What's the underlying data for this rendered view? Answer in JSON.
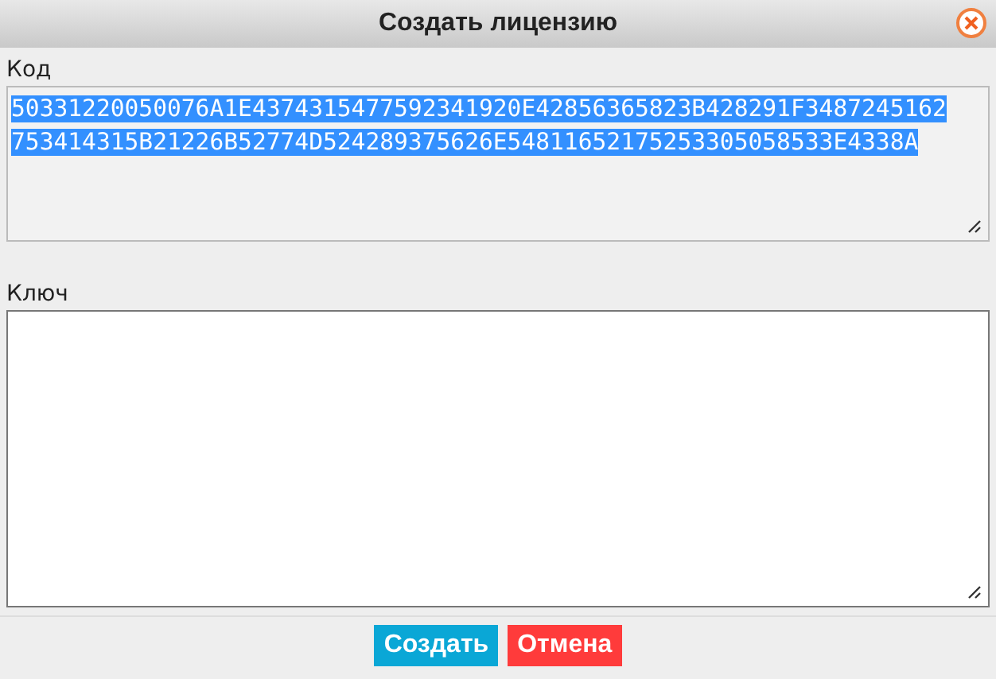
{
  "window": {
    "title": "Создать лицензию"
  },
  "code_field": {
    "label": "Код",
    "lines": [
      "50331220050076A1E4374315477592341920E42856365823B428291F3487245162",
      "753414315B21226B52774D524289375626E54811652175253305058533E4338A"
    ],
    "selected": true
  },
  "key_field": {
    "label": "Ключ"
  },
  "buttons": [
    {
      "label": "Создать",
      "kind": "primary"
    },
    {
      "label": "Отмена",
      "kind": "danger"
    }
  ]
}
